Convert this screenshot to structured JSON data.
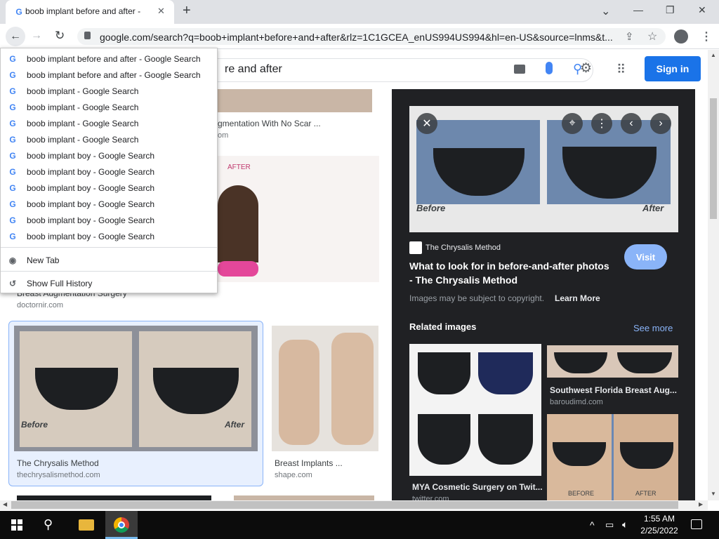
{
  "browser": {
    "tab_title": "boob implant before and after -",
    "url": "google.com/search?q=boob+implant+before+and+after&rlz=1C1GCEA_enUS994US994&hl=en-US&source=lnms&t...",
    "new_tab_symbol": "+"
  },
  "window_controls": {
    "minimize": "—",
    "restore": "❐",
    "close": "✕",
    "menu": "⌄"
  },
  "search": {
    "query": "re and after",
    "signin_label": "Sign in"
  },
  "dropdown": {
    "items": [
      "boob implant before and after - Google Search",
      "boob implant before and after - Google Search",
      "boob implant - Google Search",
      "boob implant - Google Search",
      "boob implant - Google Search",
      "boob implant - Google Search",
      "boob implant boy - Google Search",
      "boob implant boy - Google Search",
      "boob implant boy - Google Search",
      "boob implant boy - Google Search",
      "boob implant boy - Google Search",
      "boob implant boy - Google Search"
    ],
    "new_tab": "New Tab",
    "show_history": "Show Full History"
  },
  "results": {
    "r1": {
      "title": "gmentation With No Scar ...",
      "source": "om"
    },
    "r2": {
      "title": "Breast Augmentation Surgery",
      "source": "doctornir.com",
      "after_label": "AFTER"
    },
    "r3": {
      "title": "The Chrysalis Method",
      "source": "thechrysalismethod.com",
      "before": "Before",
      "after": "After"
    },
    "r4": {
      "title": "Breast Implants ...",
      "source": "shape.com"
    }
  },
  "panel": {
    "site_name": "The Chrysalis Method",
    "title": "What to look for in before-and-after photos - The Chrysalis Method",
    "visit_label": "Visit",
    "copyright_text": "Images may be subject to copyright.",
    "learn_more": "Learn More",
    "image_before": "Before",
    "image_after": "After",
    "related_heading": "Related images",
    "see_more": "See more",
    "related": [
      {
        "title": "MYA Cosmetic Surgery on Twit...",
        "source": "twitter.com"
      },
      {
        "title": "Southwest Florida Breast Aug...",
        "source": "baroudimd.com"
      },
      {
        "before": "BEFORE",
        "after": "AFTER"
      }
    ]
  },
  "taskbar": {
    "time": "1:55 AM",
    "date": "2/25/2022"
  },
  "colors": {
    "accent": "#1a73e8",
    "panel_bg": "#202124",
    "visit": "#8ab4f8"
  }
}
